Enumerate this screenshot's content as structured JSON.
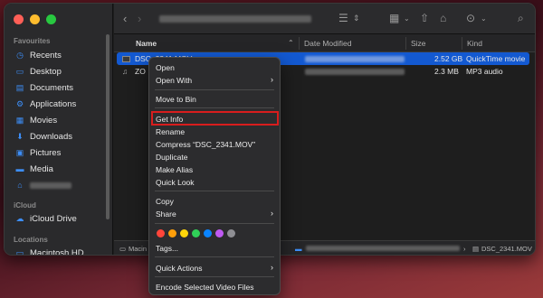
{
  "sidebar": {
    "favourites_label": "Favourites",
    "items": [
      {
        "label": "Recents",
        "icon": "◷",
        "name": "clock-icon"
      },
      {
        "label": "Desktop",
        "icon": "▭",
        "name": "desktop-icon"
      },
      {
        "label": "Documents",
        "icon": "▤",
        "name": "document-icon"
      },
      {
        "label": "Applications",
        "icon": "⚙",
        "name": "applications-icon"
      },
      {
        "label": "Movies",
        "icon": "▦",
        "name": "movies-icon"
      },
      {
        "label": "Downloads",
        "icon": "⬇",
        "name": "download-icon"
      },
      {
        "label": "Pictures",
        "icon": "▣",
        "name": "pictures-icon"
      },
      {
        "label": "Media",
        "icon": "▬",
        "name": "folder-icon"
      }
    ],
    "icloud_label": "iCloud",
    "icloud_drive": "iCloud Drive",
    "locations_label": "Locations",
    "macintosh_hd": "Macintosh HD"
  },
  "columns": {
    "name": "Name",
    "date_modified": "Date Modified",
    "size": "Size",
    "kind": "Kind"
  },
  "files": [
    {
      "name": "DSC_2341.MOV",
      "size": "2.52 GB",
      "kind": "QuickTime movie"
    },
    {
      "name": "ZO",
      "size": "2.3 MB",
      "kind": "MP3 audio"
    }
  ],
  "pathbar": {
    "root": "Macin",
    "file": "DSC_2341.MOV"
  },
  "context_menu": {
    "open": "Open",
    "open_with": "Open With",
    "move_to_bin": "Move to Bin",
    "get_info": "Get Info",
    "rename": "Rename",
    "compress": "Compress “DSC_2341.MOV”",
    "duplicate": "Duplicate",
    "make_alias": "Make Alias",
    "quick_look": "Quick Look",
    "copy": "Copy",
    "share": "Share",
    "tags_label": "Tags...",
    "quick_actions": "Quick Actions",
    "encode": "Encode Selected Video Files",
    "tag_colors": [
      "#ff453a",
      "#ff9f0a",
      "#ffd60a",
      "#30d158",
      "#0a84ff",
      "#bf5af2",
      "#8e8e93"
    ],
    "highlight_color": "#d81d1d"
  },
  "colors": {
    "selection": "#1359d1",
    "accent": "#3d8ef7"
  }
}
